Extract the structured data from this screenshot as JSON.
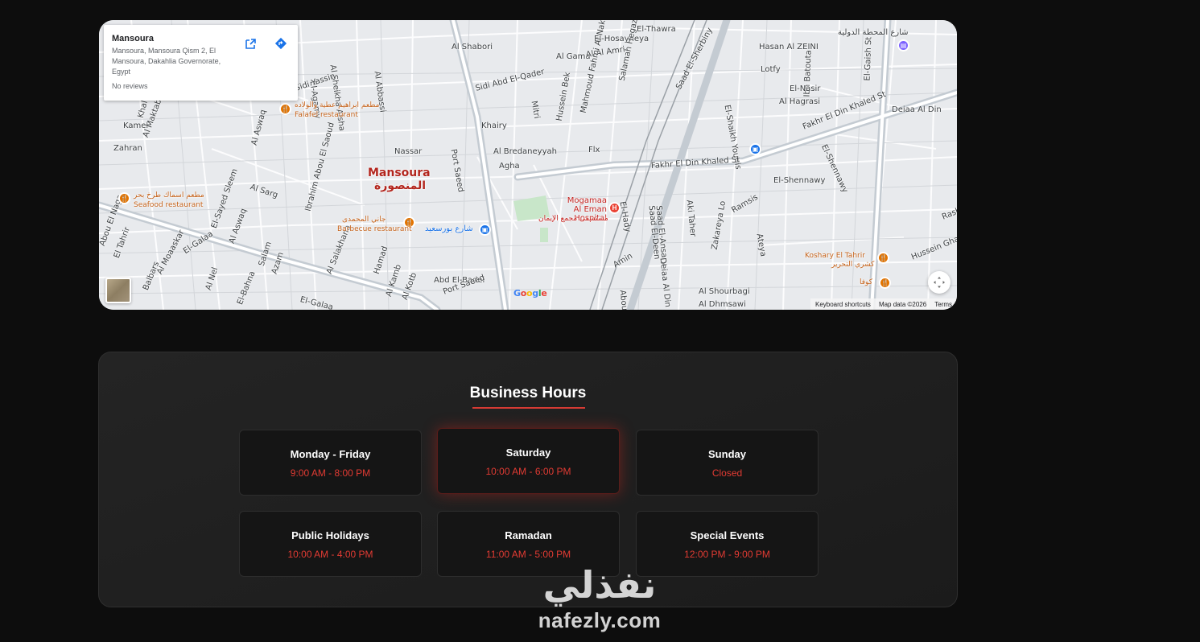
{
  "map": {
    "place_card": {
      "name": "Mansoura",
      "address": "Mansoura, Mansoura Qism 2, El Mansoura, Dakahlia Governorate, Egypt",
      "reviews": "No reviews",
      "open_icon": "open-in-new-icon",
      "directions_icon": "directions-icon"
    },
    "city_label": "Mansoura",
    "city_label_ar": "المنصورة",
    "streets": [
      "Al Shabori",
      "Al Gama",
      "Al Al Amri",
      "El-Hosayneya",
      "El-Thawra",
      "Saad El-Sherbiny",
      "Hasan Al ZEINI",
      "Ibn Batouta",
      "El-Gaish St",
      "Lotfy",
      "El-Shaikh Younis",
      "El-Nasir",
      "Al Hagrasi",
      "Fakhr El Din Khaled St",
      "Deiaa Al Din",
      "El-Shennawy",
      "Sidi Abd El-Qader",
      "Mitri",
      "Hussein Bek",
      "Mahmoud Fahmi Al Nakrashi",
      "Salamah Hegazy",
      "Port Saeed",
      "Khairy",
      "Nassar",
      "Al Bredaneyyah",
      "Agha",
      "Flx",
      "Al Abbassi",
      "Al Sheikha Aisha",
      "El-Agamy",
      "Sidi Yassin",
      "Kamel",
      "Khaleel Ha",
      "Zahran",
      "Al Maktab Al Sharqi",
      "Al Aswaq",
      "Al Sarg",
      "El-Galaa",
      "El-Sayed Sleem",
      "Al Aswaq",
      "Ibrahim Abou El Saoud",
      "El-Hady",
      "Saad El-Ansary",
      "Saad El-Deen",
      "Aki Taher",
      "Ramsis",
      "Ateya",
      "Zakareya Lo",
      "Rashad K",
      "Hussein Ghalel",
      "Amin",
      "Abou El-Qa",
      "Deiaa Al Din",
      "Al Shourbagi",
      "Al Dhmsawi",
      "Al Moaaskar",
      "Al Nel",
      "Salam",
      "Azam",
      "Al Salakhana",
      "Hamad",
      "Al Kamb",
      "Abd El-Badei",
      "Port Saeed",
      "Abou El Naga",
      "El Tahrir",
      "Balbars",
      "El-Bahna",
      "Al Kotb",
      "El-Galaa",
      "Fakhr El Din Khaled St",
      "El-Shennawy"
    ],
    "pois": [
      {
        "name": "مطعم ابراهيم عطية والولاده",
        "sub": "Falafel restaurant"
      },
      {
        "name": "مطعم اسماك طرخ بحر",
        "sub": "Seafood restaurant"
      },
      {
        "name": "جاني المحمدى",
        "sub": "Barbecue restaurant"
      },
      {
        "name": "شارع بورسعيد",
        "sub": ""
      },
      {
        "name": "Koshary El Tahrir",
        "sub": "كشري التحرير"
      },
      {
        "name": "كوفا",
        "sub": ""
      },
      {
        "name": "شارع المحطة الدولية",
        "sub": ""
      }
    ],
    "hospital": {
      "name": "Mogamaa Al Eman Hospital",
      "name_ar": "مستشفى مجمع الإيمان"
    },
    "google": "Google",
    "attribution": [
      "Keyboard shortcuts",
      "Map data ©2026",
      "Terms"
    ],
    "fullscreen_icon": "fullscreen-icon"
  },
  "business_hours": {
    "title": "Business Hours",
    "cards": [
      {
        "day": "Monday - Friday",
        "time": "9:00 AM - 8:00 PM",
        "active": false
      },
      {
        "day": "Saturday",
        "time": "10:00 AM - 6:00 PM",
        "active": true
      },
      {
        "day": "Sunday",
        "time": "Closed",
        "active": false
      },
      {
        "day": "Public Holidays",
        "time": "10:00 AM - 4:00 PM",
        "active": false
      },
      {
        "day": "Ramadan",
        "time": "11:00 AM - 5:00 PM",
        "active": false
      },
      {
        "day": "Special Events",
        "time": "12:00 PM - 9:00 PM",
        "active": false
      }
    ]
  },
  "watermark": {
    "arabic": "نفذلي",
    "latin": "nafezly.com"
  },
  "colors": {
    "accent": "#e23b33",
    "background": "#0d0d0d",
    "card": "#151515"
  }
}
